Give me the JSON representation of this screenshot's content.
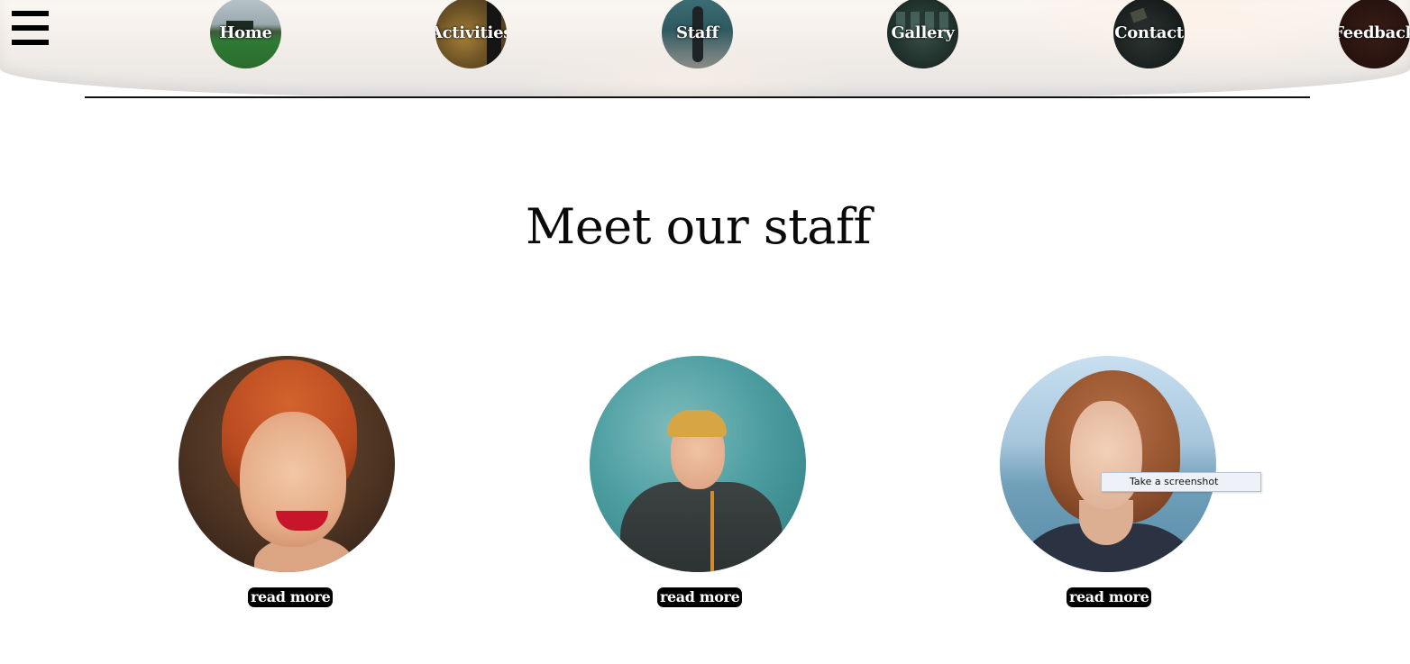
{
  "nav": {
    "menu_icon": "hamburger-menu-icon",
    "items": [
      {
        "label": "Home"
      },
      {
        "label": "Activities"
      },
      {
        "label": "Staff"
      },
      {
        "label": "Gallery"
      },
      {
        "label": "Contact"
      },
      {
        "label": "Feedback"
      }
    ]
  },
  "main": {
    "title": "Meet our staff",
    "staff": [
      {
        "button_label": "read more"
      },
      {
        "button_label": "read more"
      },
      {
        "button_label": "read more"
      }
    ]
  },
  "tooltip": {
    "text": "Take a screenshot"
  },
  "colors": {
    "button_background": "#000000",
    "button_text": "#ffffff",
    "title_text": "#0a0a0a"
  }
}
